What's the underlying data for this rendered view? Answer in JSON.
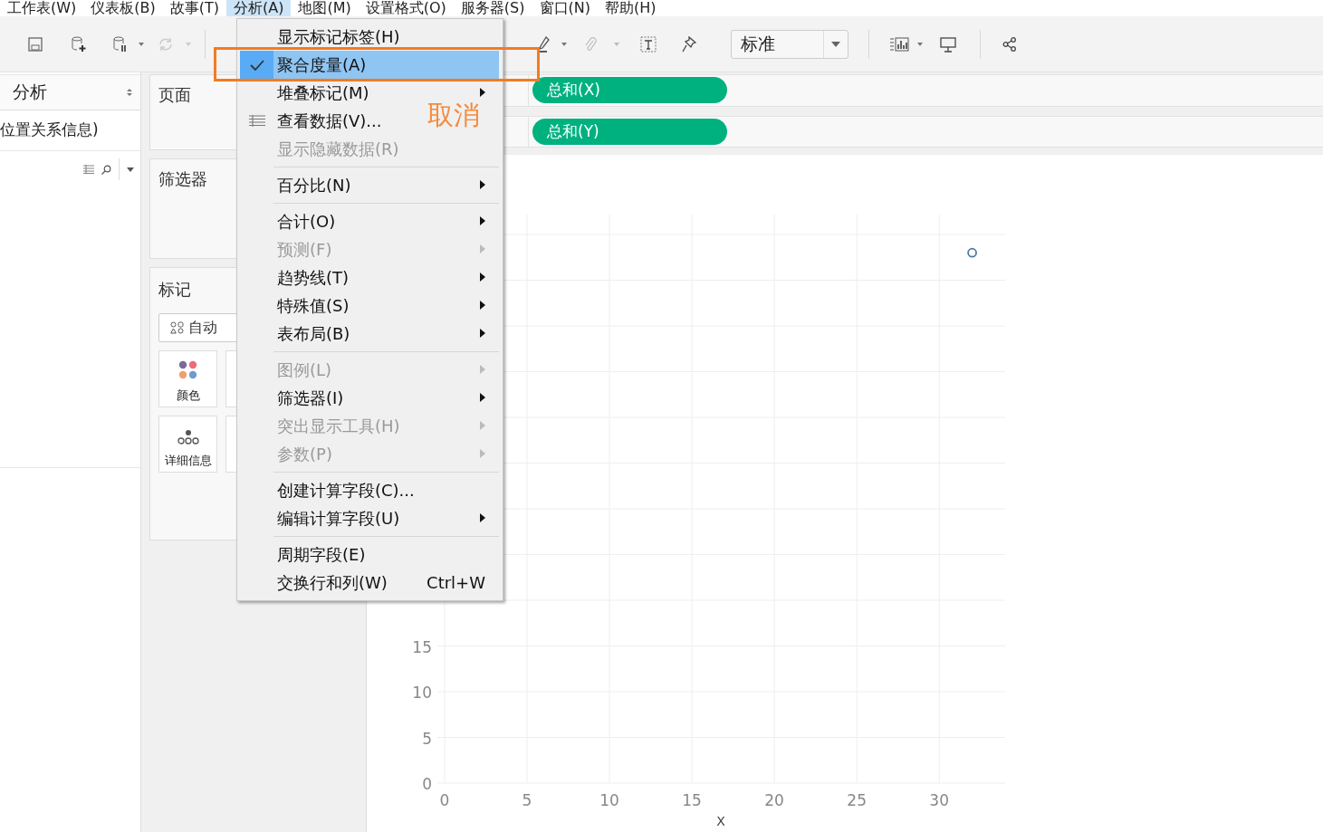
{
  "menubar": [
    {
      "label": "工作表(W)",
      "selected": false
    },
    {
      "label": "仪表板(B)",
      "selected": false
    },
    {
      "label": "故事(T)",
      "selected": false
    },
    {
      "label": "分析(A)",
      "selected": true
    },
    {
      "label": "地图(M)",
      "selected": false
    },
    {
      "label": "设置格式(O)",
      "selected": false
    },
    {
      "label": "服务器(S)",
      "selected": false
    },
    {
      "label": "窗口(N)",
      "selected": false
    },
    {
      "label": "帮助(H)",
      "selected": false
    }
  ],
  "toolbar": {
    "mark_size": "标准"
  },
  "data_pane": {
    "title": "分析",
    "field": "位置关系信息)"
  },
  "cards": {
    "pages": "页面",
    "filters": "筛选器",
    "marks": {
      "title": "标记",
      "mark_type": "自动",
      "tiles": [
        {
          "label": "颜色",
          "kind": "color"
        },
        {
          "label": "详细信息",
          "kind": "detail"
        }
      ]
    }
  },
  "shelves": [
    {
      "pill": "总和(X)"
    },
    {
      "pill": "总和(Y)"
    }
  ],
  "menu": {
    "items": [
      {
        "kind": "item",
        "label": "显示标记标签(H)",
        "checked": false,
        "selected": false,
        "disabled": false,
        "submenu": false
      },
      {
        "kind": "item",
        "label": "聚合度量(A)",
        "checked": true,
        "selected": true,
        "disabled": false,
        "submenu": false
      },
      {
        "kind": "item",
        "label": "堆叠标记(M)",
        "checked": false,
        "selected": false,
        "disabled": false,
        "submenu": true
      },
      {
        "kind": "table_item",
        "label": "查看数据(V)...",
        "checked": false,
        "selected": false,
        "disabled": false,
        "submenu": false
      },
      {
        "kind": "item",
        "label": "显示隐藏数据(R)",
        "checked": false,
        "selected": false,
        "disabled": true,
        "submenu": false
      },
      {
        "kind": "separator"
      },
      {
        "kind": "item",
        "label": "百分比(N)",
        "checked": false,
        "selected": false,
        "disabled": false,
        "submenu": true
      },
      {
        "kind": "separator"
      },
      {
        "kind": "item",
        "label": "合计(O)",
        "checked": false,
        "selected": false,
        "disabled": false,
        "submenu": true
      },
      {
        "kind": "item",
        "label": "预测(F)",
        "checked": false,
        "selected": false,
        "disabled": true,
        "submenu": true
      },
      {
        "kind": "item",
        "label": "趋势线(T)",
        "checked": false,
        "selected": false,
        "disabled": false,
        "submenu": true
      },
      {
        "kind": "item",
        "label": "特殊值(S)",
        "checked": false,
        "selected": false,
        "disabled": false,
        "submenu": true
      },
      {
        "kind": "item",
        "label": "表布局(B)",
        "checked": false,
        "selected": false,
        "disabled": false,
        "submenu": true
      },
      {
        "kind": "separator"
      },
      {
        "kind": "item",
        "label": "图例(L)",
        "checked": false,
        "selected": false,
        "disabled": true,
        "submenu": true
      },
      {
        "kind": "item",
        "label": "筛选器(I)",
        "checked": false,
        "selected": false,
        "disabled": false,
        "submenu": true
      },
      {
        "kind": "item",
        "label": "突出显示工具(H)",
        "checked": false,
        "selected": false,
        "disabled": true,
        "submenu": true
      },
      {
        "kind": "item",
        "label": "参数(P)",
        "checked": false,
        "selected": false,
        "disabled": true,
        "submenu": true
      },
      {
        "kind": "separator"
      },
      {
        "kind": "item",
        "label": "创建计算字段(C)...",
        "checked": false,
        "selected": false,
        "disabled": false,
        "submenu": false
      },
      {
        "kind": "item",
        "label": "编辑计算字段(U)",
        "checked": false,
        "selected": false,
        "disabled": false,
        "submenu": true
      },
      {
        "kind": "separator"
      },
      {
        "kind": "item",
        "label": "周期字段(E)",
        "checked": false,
        "selected": false,
        "disabled": false,
        "submenu": false
      },
      {
        "kind": "item",
        "label": "交换行和列(W)",
        "checked": false,
        "selected": false,
        "disabled": false,
        "submenu": false,
        "shortcut": "Ctrl+W"
      }
    ]
  },
  "annotation": {
    "text": "取消"
  },
  "chart": {
    "chart_data": {
      "type": "scatter",
      "xlabel": "X",
      "x": [
        32
      ],
      "series": [
        {
          "color": "#4e79a7",
          "values": [
            58
          ]
        }
      ],
      "xlim": [
        0,
        34
      ],
      "ylim": [
        0,
        60
      ],
      "xticks": [
        0,
        5,
        10,
        15,
        20,
        25,
        30
      ],
      "yticks": [
        0,
        5,
        10,
        15
      ],
      "grid": true
    }
  }
}
